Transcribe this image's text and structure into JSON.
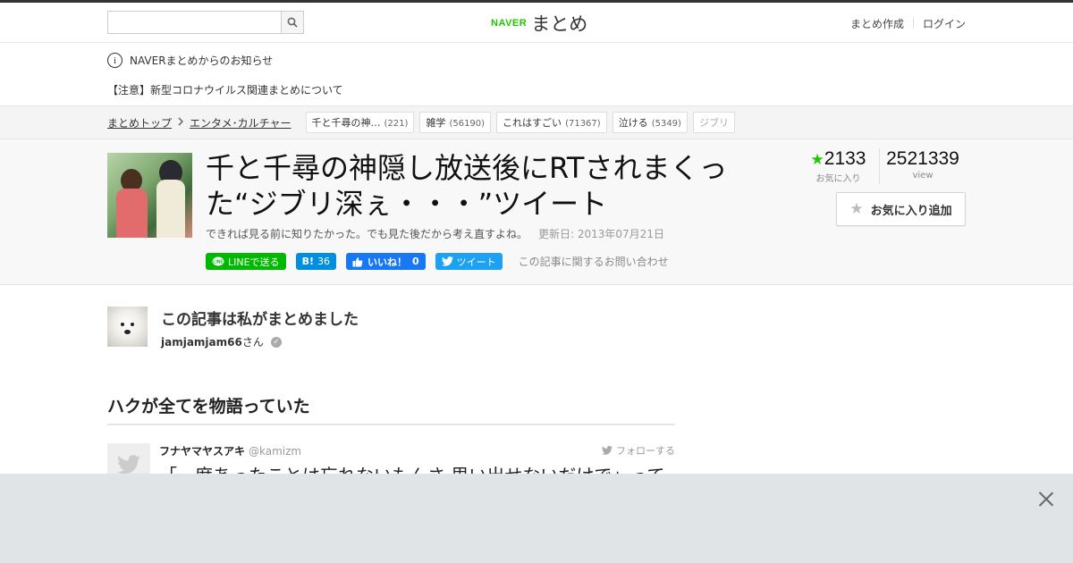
{
  "header": {
    "search_placeholder": "",
    "logo_naver": "NAVER",
    "logo_matome": "まとめ",
    "links": [
      "まとめ作成",
      "ログイン"
    ]
  },
  "notice": {
    "announcement": "NAVERまとめからのお知らせ",
    "headline": "【注意】新型コロナウイルス関連まとめについて"
  },
  "breadcrumb": {
    "top": "まとめトップ",
    "category": "エンタメ･カルチャー",
    "tags": [
      {
        "label": "千と千尋の神…",
        "count": "(221)"
      },
      {
        "label": "雑学",
        "count": "(56190)"
      },
      {
        "label": "これはすごい",
        "count": "(71367)"
      },
      {
        "label": "泣ける",
        "count": "(5349)"
      },
      {
        "label": "ジブリ",
        "count": ""
      }
    ]
  },
  "article": {
    "title": "千と千尋の神隠し放送後にRTされまくった“ジブリ深ぇ・・・”ツイート",
    "description": "できれば見る前に知りたかった。でも見た後だから考え直すよね。",
    "updated": "更新日: 2013年07月21日",
    "share": {
      "line": "LINEで送る",
      "hatena_icon": "B!",
      "hatena_count": "36",
      "facebook": "いいね！",
      "facebook_count": "0",
      "tweet": "ツイート",
      "contact": "この記事に関するお問い合わせ"
    },
    "stats": {
      "favorites": "2133",
      "favorites_label": "お気に入り",
      "views": "2521339",
      "views_label": "view"
    },
    "fav_button": "お気に入り追加"
  },
  "author": {
    "heading": "この記事は私がまとめました",
    "name": "jamjamjam66",
    "suffix": "さん"
  },
  "section": {
    "heading": "ハクが全てを物語っていた"
  },
  "tweet": {
    "name": "フナヤマヤスアキ",
    "handle": "@kamizm",
    "follow": "フォローする",
    "text": "「一度あったことは忘れないもんさ 思い出せないだけで」って"
  },
  "colors": {
    "naver_green": "#1ec800",
    "line_green": "#00b900",
    "hatena_blue": "#008fde",
    "facebook_blue": "#1877f2",
    "twitter_blue": "#1da1f2"
  }
}
